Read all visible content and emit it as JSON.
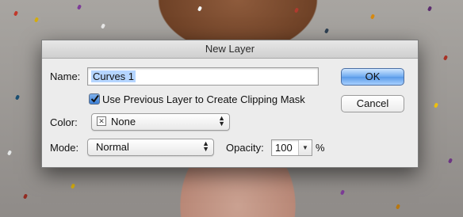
{
  "dialog": {
    "title": "New Layer",
    "name_label": "Name:",
    "name_value": "Curves 1",
    "checkbox_label": "Use Previous Layer to Create Clipping Mask",
    "checkbox_checked": true,
    "color_label": "Color:",
    "color_value": "None",
    "mode_label": "Mode:",
    "mode_value": "Normal",
    "opacity_label": "Opacity:",
    "opacity_value": "100",
    "opacity_unit": "%",
    "ok_label": "OK",
    "cancel_label": "Cancel",
    "icons": {
      "checkbox": "checkmark-icon",
      "color_swatch": "no-color-x-icon",
      "popup_arrows": "up-down-arrows-icon",
      "dropdown": "chevron-down-icon"
    },
    "accent_color": "#5a9ae8"
  }
}
